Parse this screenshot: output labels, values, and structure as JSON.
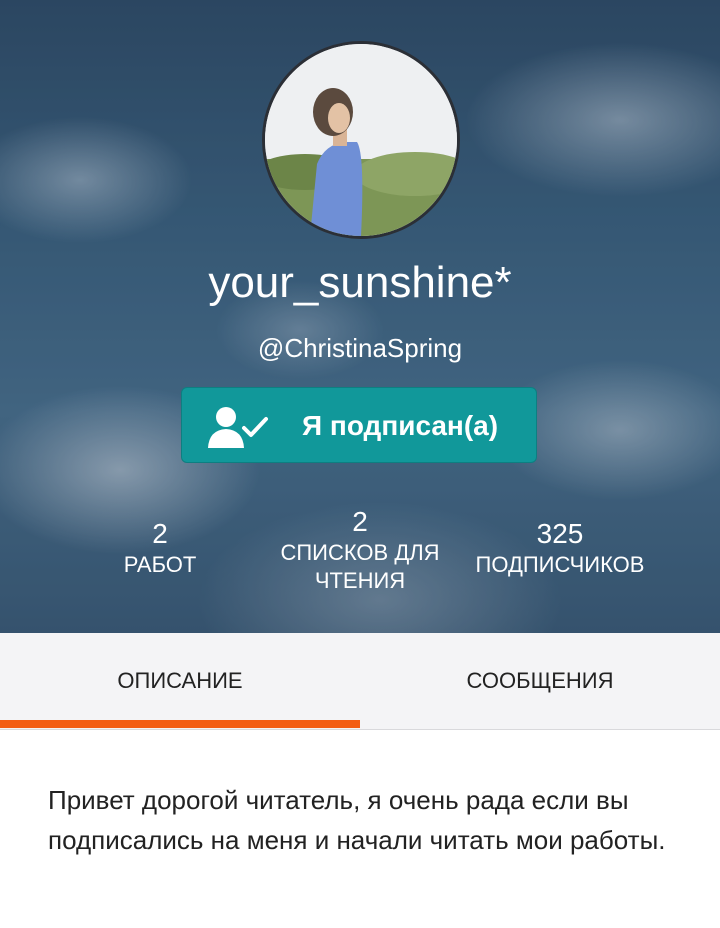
{
  "profile": {
    "username": "your_sunshine*",
    "handle": "@ChristinaSpring",
    "follow_button_label": "Я подписан(а)"
  },
  "stats": {
    "works": {
      "value": "2",
      "label": "РАБОТ"
    },
    "reading_lists": {
      "value": "2",
      "label": "СПИСКОВ ДЛЯ ЧТЕНИЯ"
    },
    "followers": {
      "value": "325",
      "label": "ПОДПИСЧИКОВ"
    }
  },
  "tabs": [
    {
      "label": "ОПИСАНИЕ",
      "active": true
    },
    {
      "label": "СООБЩЕНИЯ",
      "active": false
    }
  ],
  "description": "Привет дорогой читатель, я очень рада если вы подписались на меня и начали читать мои работы.",
  "colors": {
    "follow_button": "#11989a",
    "tab_indicator": "#f35d14"
  },
  "icons": {
    "follow_button": "user-check-icon"
  }
}
